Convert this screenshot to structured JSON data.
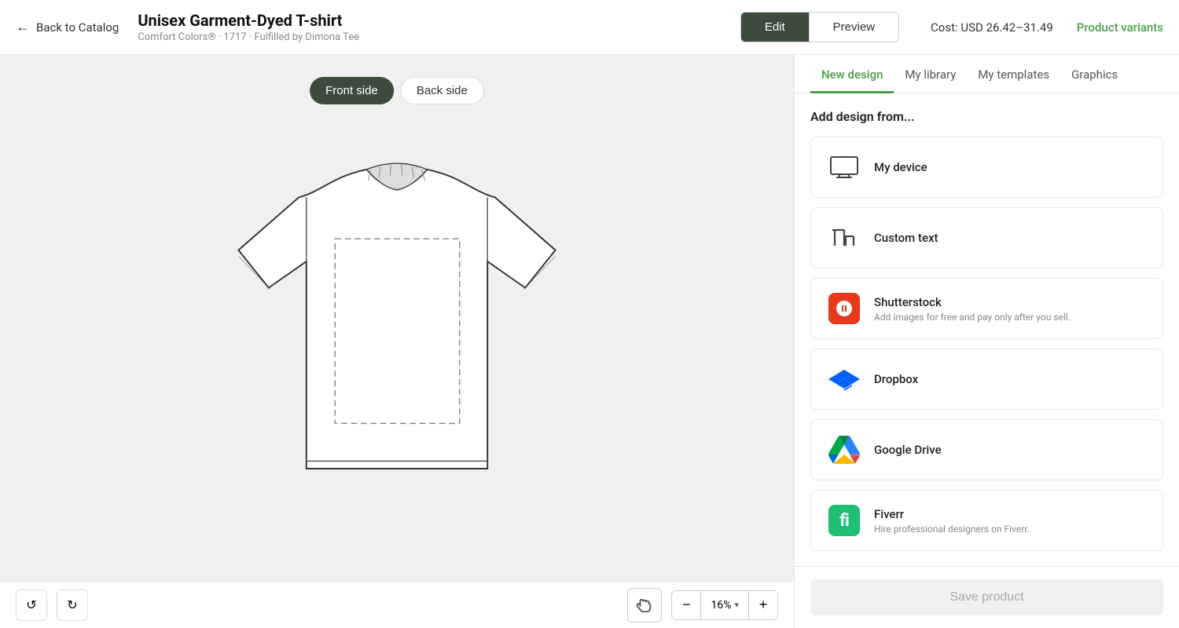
{
  "header": {
    "back_label": "Back to Catalog",
    "product_title": "Unisex Garment-Dyed T-shirt",
    "product_subtitle": "Comfort Colors® · 1717 · Fulfilled by Dimona Tee",
    "edit_label": "Edit",
    "preview_label": "Preview",
    "cost_label": "Cost: USD 26.42–31.49",
    "variants_label": "Product variants"
  },
  "canvas": {
    "front_side_label": "Front side",
    "back_side_label": "Back side"
  },
  "toolbar": {
    "undo_label": "↺",
    "redo_label": "↻",
    "zoom_value": "16%",
    "zoom_minus": "−",
    "zoom_plus": "+"
  },
  "panel": {
    "tabs": [
      {
        "label": "New design",
        "active": true
      },
      {
        "label": "My library",
        "active": false
      },
      {
        "label": "My templates",
        "active": false
      },
      {
        "label": "Graphics",
        "active": false
      }
    ],
    "add_design_label": "Add design from...",
    "options": [
      {
        "id": "my-device",
        "title": "My device",
        "subtitle": "",
        "icon_type": "monitor"
      },
      {
        "id": "custom-text",
        "title": "Custom text",
        "subtitle": "",
        "icon_type": "text"
      },
      {
        "id": "shutterstock",
        "title": "Shutterstock",
        "subtitle": "Add images for free and pay only after you sell.",
        "icon_type": "shutterstock"
      },
      {
        "id": "dropbox",
        "title": "Dropbox",
        "subtitle": "",
        "icon_type": "dropbox"
      },
      {
        "id": "google-drive",
        "title": "Google Drive",
        "subtitle": "",
        "icon_type": "gdrive"
      },
      {
        "id": "fiverr",
        "title": "Fiverr",
        "subtitle": "Hire professional designers on Fiverr.",
        "icon_type": "fiverr"
      }
    ],
    "save_label": "Save product"
  }
}
